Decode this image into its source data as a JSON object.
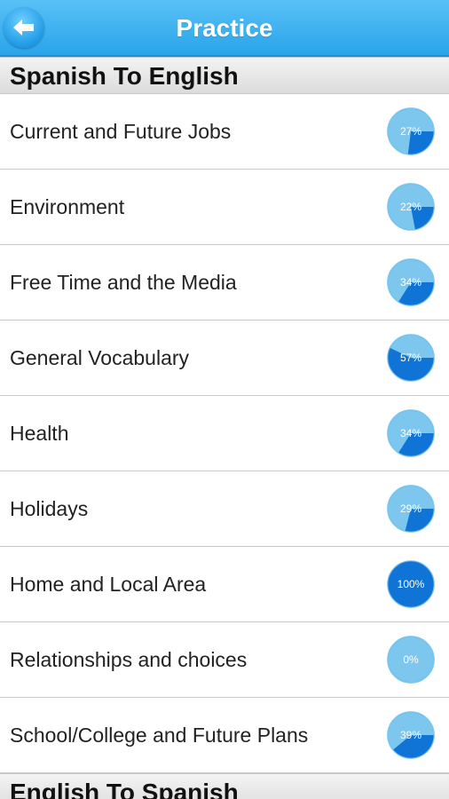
{
  "header": {
    "title": "Practice",
    "back_icon": "arrow-left-icon"
  },
  "sections": [
    {
      "title": "Spanish To English",
      "items": [
        {
          "label": "Current and Future Jobs",
          "progress_text": "27%",
          "progress": 27
        },
        {
          "label": "Environment",
          "progress_text": "22%",
          "progress": 22
        },
        {
          "label": "Free Time and the Media",
          "progress_text": "34%",
          "progress": 34
        },
        {
          "label": "General Vocabulary",
          "progress_text": "57%",
          "progress": 57
        },
        {
          "label": "Health",
          "progress_text": "34%",
          "progress": 34
        },
        {
          "label": "Holidays",
          "progress_text": "29%",
          "progress": 29
        },
        {
          "label": "Home and Local Area",
          "progress_text": "100%",
          "progress": 100
        },
        {
          "label": "Relationships and choices",
          "progress_text": "0%",
          "progress": 0
        },
        {
          "label": "School/College and Future Plans",
          "progress_text": "39%",
          "progress": 39
        }
      ]
    },
    {
      "title": "English To Spanish",
      "items": []
    }
  ],
  "colors": {
    "header": "#29a4ea",
    "progress_track": "#7dc7ee",
    "progress_fill": "#0f74d6",
    "progress_border": "#45b1ea"
  }
}
